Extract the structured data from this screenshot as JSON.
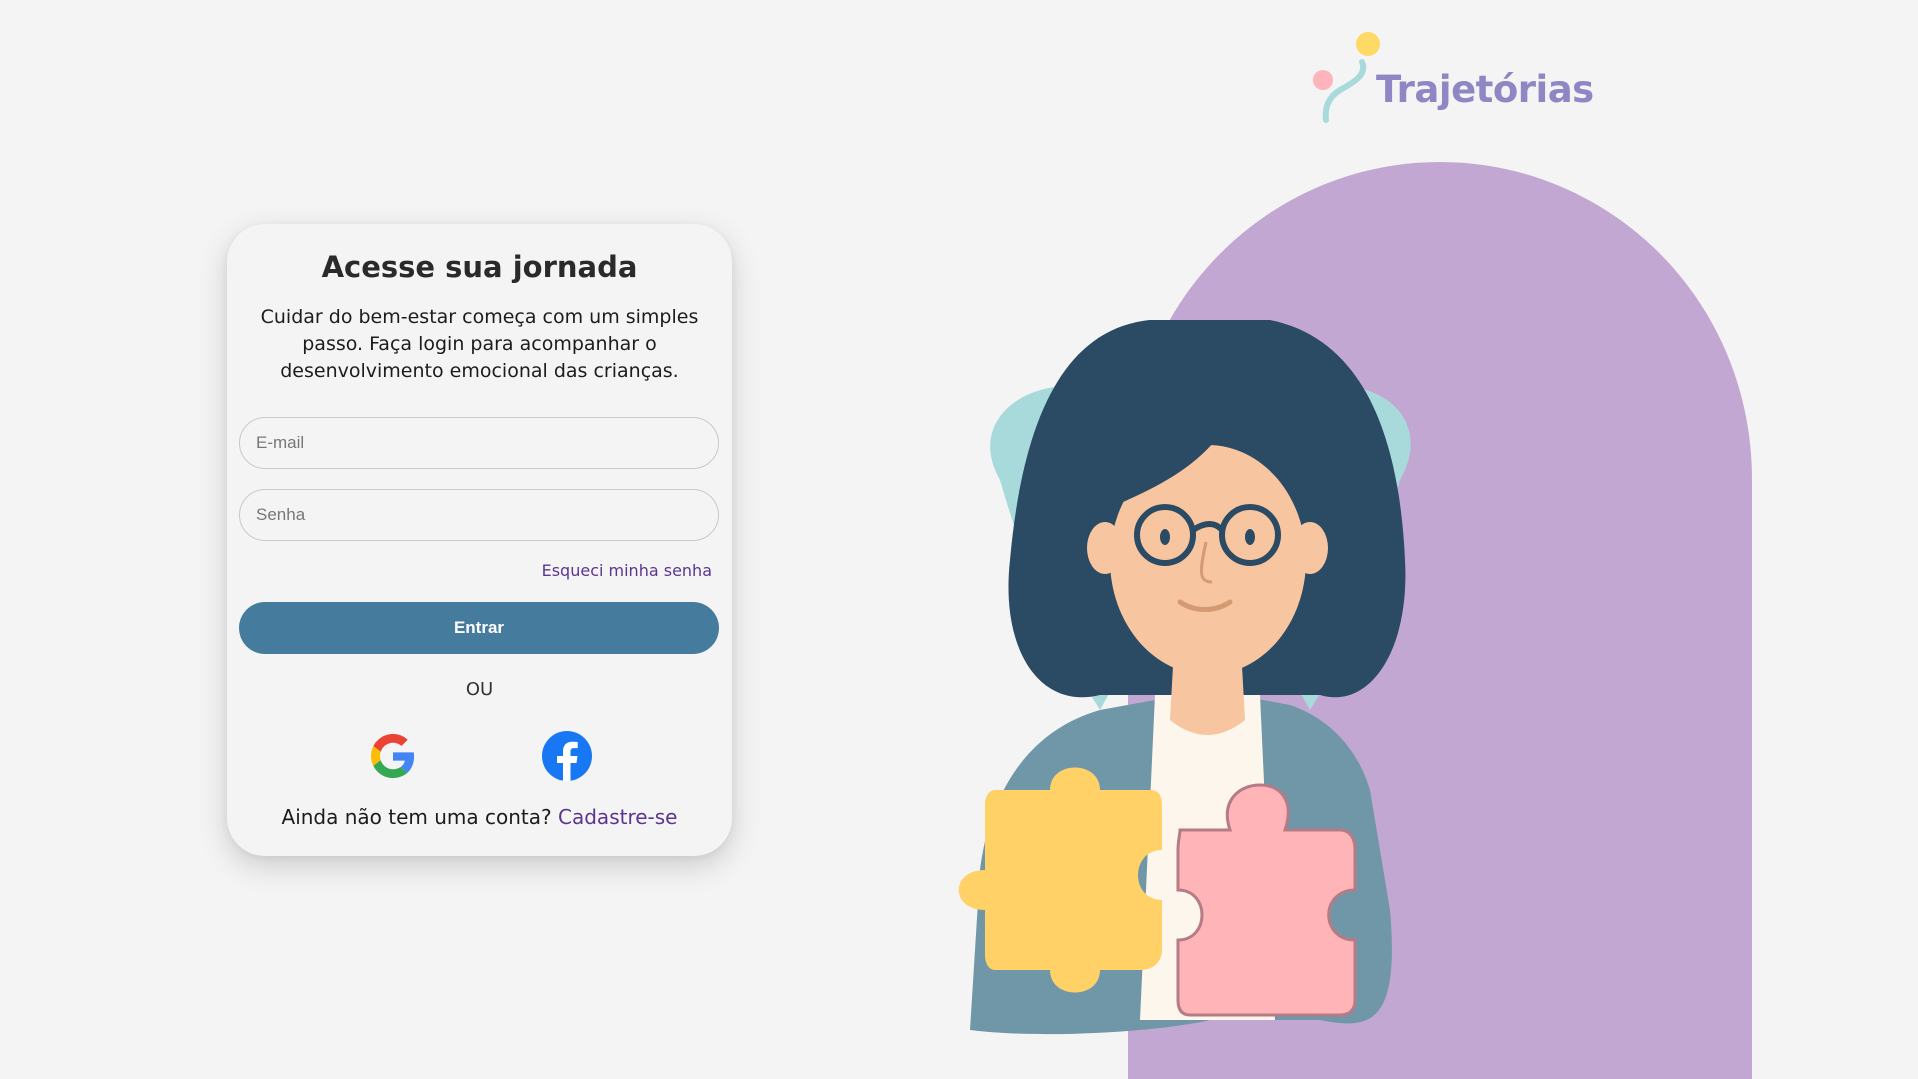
{
  "login": {
    "title": "Acesse sua jornada",
    "subtitle": "Cuidar do bem-estar começa com um simples passo. Faça login para acompanhar o desenvolvimento emocional das crianças.",
    "email_placeholder": "E-mail",
    "password_placeholder": "Senha",
    "forgot_label": "Esqueci minha senha",
    "submit_label": "Entrar",
    "divider": "OU",
    "social": [
      {
        "name": "Google",
        "icon": "google-icon"
      },
      {
        "name": "Facebook",
        "icon": "facebook-icon"
      }
    ],
    "signup_prompt": "Ainda não tem uma conta?",
    "signup_link": "Cadastre-se"
  },
  "brand": {
    "name": "Trajetórias"
  },
  "colors": {
    "background": "#f4f4f4",
    "primary_button": "#457b9d",
    "link": "#5b3591",
    "arch": "#c3a7d3",
    "logo_text": "#8f86c4",
    "puzzle_yellow": "#ffd166",
    "puzzle_pink": "#ffb5b8",
    "leaf_teal": "#a8dadc"
  },
  "illustration": {
    "icon": "woman-with-puzzle-illustration"
  }
}
